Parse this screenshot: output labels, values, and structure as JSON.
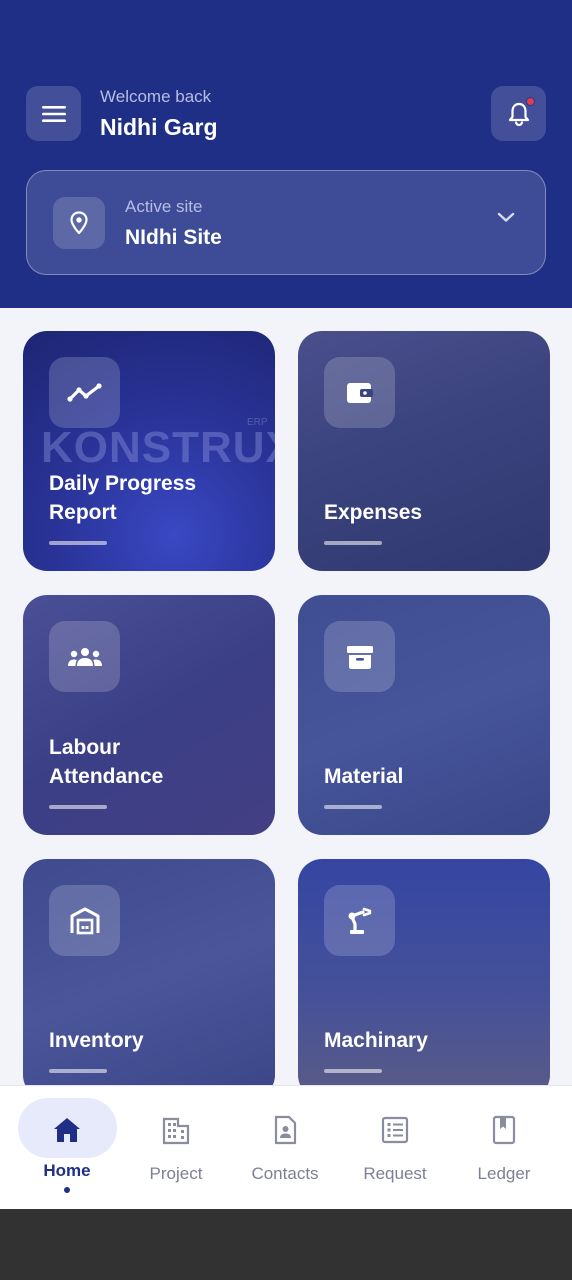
{
  "header": {
    "welcome": "Welcome back",
    "username": "Nidhi Garg",
    "menu_icon": "menu-icon",
    "bell_icon": "bell-icon",
    "notification_dot_color": "#e53950"
  },
  "site": {
    "label": "Active site",
    "name": "NIdhi Site",
    "icon": "location-pin-icon",
    "chevron": "chevron-down-icon"
  },
  "tiles": [
    {
      "title_line1": "Daily Progress",
      "title_line2": "Report",
      "icon": "trend-line-icon",
      "watermark": "KONSTRUX",
      "watermark_sup": "ERP"
    },
    {
      "title_line1": "Expenses",
      "title_line2": "",
      "icon": "wallet-icon"
    },
    {
      "title_line1": "Labour",
      "title_line2": "Attendance",
      "icon": "group-icon"
    },
    {
      "title_line1": "Material",
      "title_line2": "",
      "icon": "archive-box-icon"
    },
    {
      "title_line1": "Inventory",
      "title_line2": "",
      "icon": "warehouse-icon"
    },
    {
      "title_line1": "Machinary",
      "title_line2": "",
      "icon": "robot-arm-icon"
    }
  ],
  "nav": [
    {
      "label": "Home",
      "icon": "home-icon",
      "active": true
    },
    {
      "label": "Project",
      "icon": "building-icon",
      "active": false
    },
    {
      "label": "Contacts",
      "icon": "contact-card-icon",
      "active": false
    },
    {
      "label": "Request",
      "icon": "list-icon",
      "active": false
    },
    {
      "label": "Ledger",
      "icon": "book-icon",
      "active": false
    }
  ],
  "colors": {
    "primary": "#1f2f86",
    "background": "#f3f4f9",
    "nav_active_pill": "#e6eafb"
  }
}
